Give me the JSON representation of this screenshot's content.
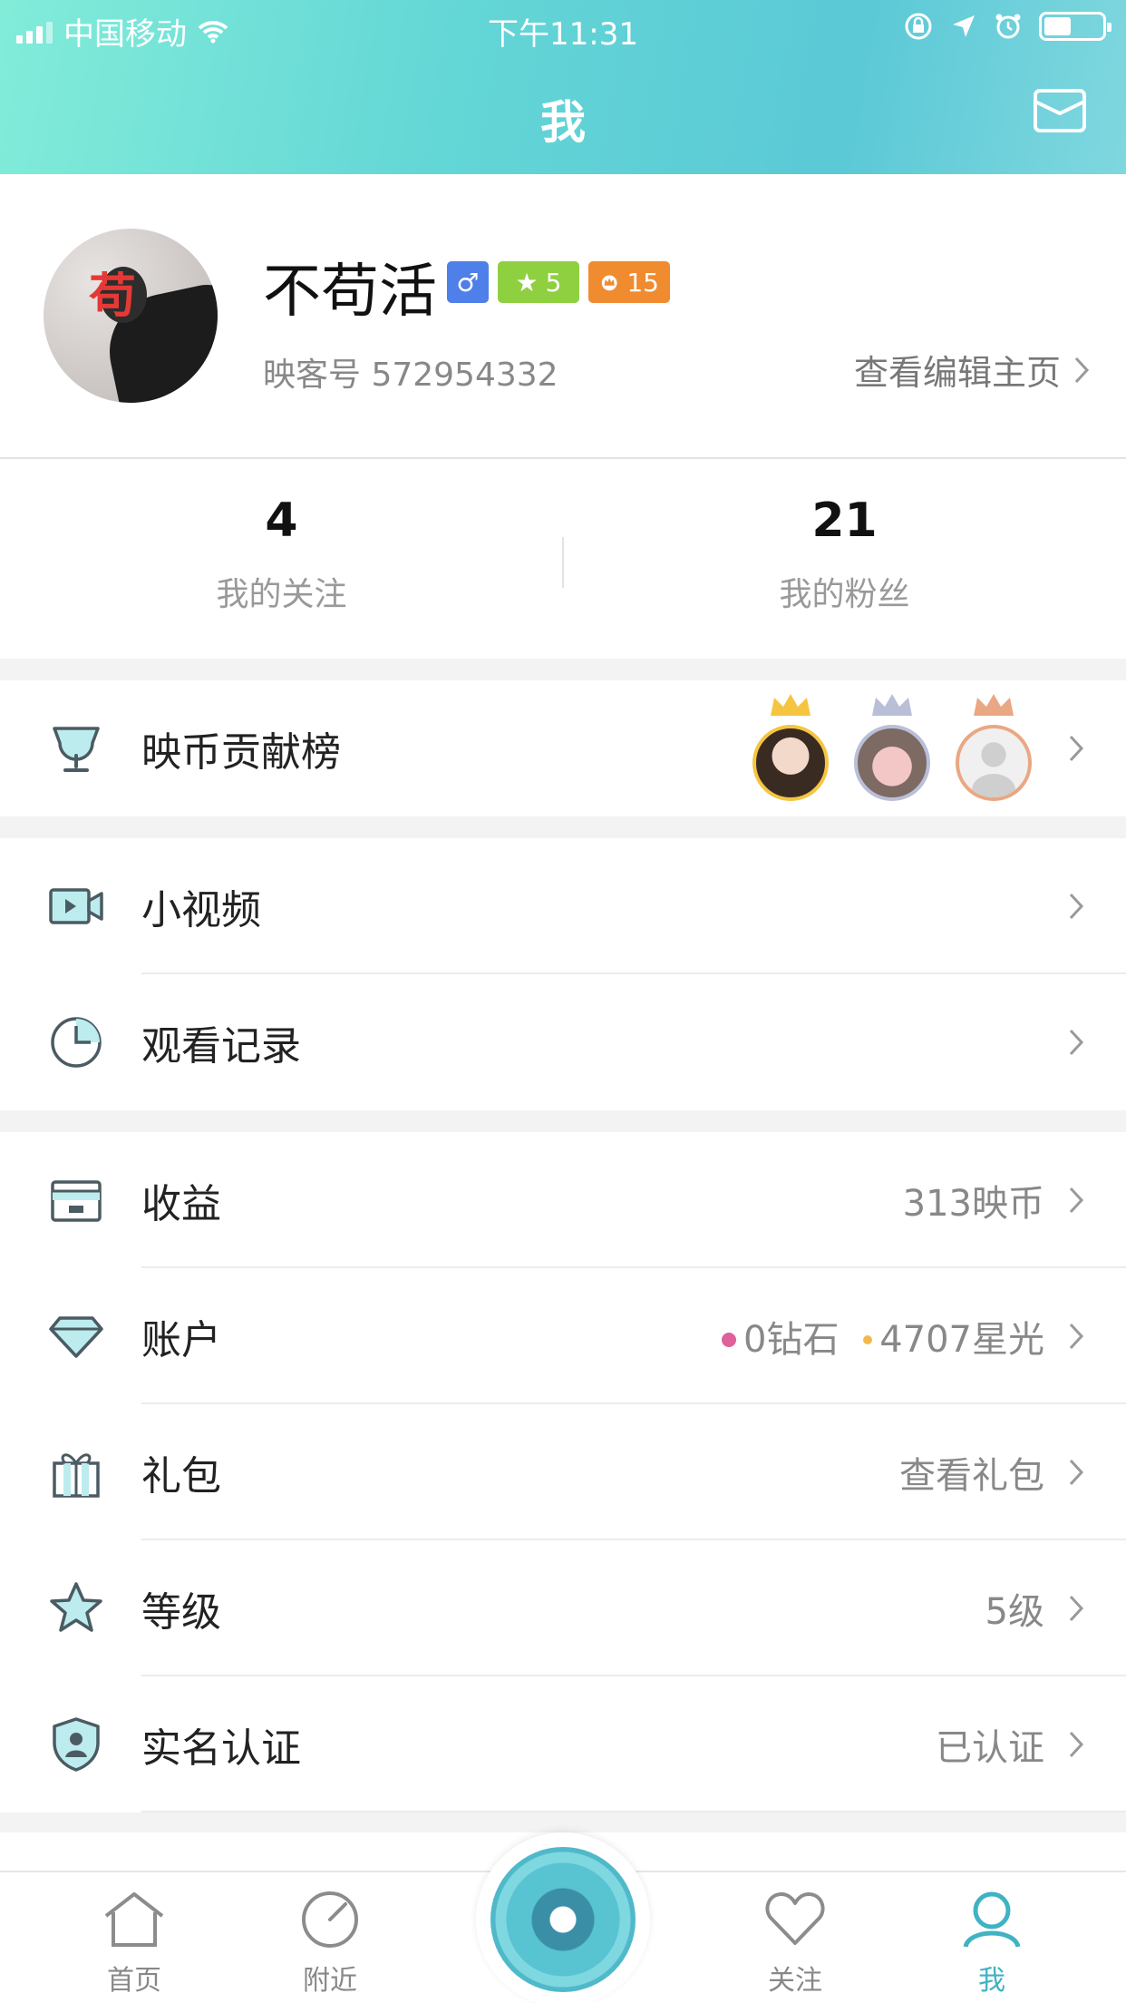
{
  "status_bar": {
    "carrier": "中国移动",
    "time": "下午11:31"
  },
  "nav": {
    "title": "我"
  },
  "profile": {
    "username": "不苟活",
    "gender_symbol": "♂",
    "level_badge": "5",
    "crown_badge": "15",
    "id_text": "映客号 572954332",
    "edit_link": "查看编辑主页"
  },
  "stats": [
    {
      "value": "4",
      "label": "我的关注"
    },
    {
      "value": "21",
      "label": "我的粉丝"
    }
  ],
  "contribution": {
    "label": "映币贡献榜"
  },
  "menu_a": [
    {
      "label": "小视频",
      "value": ""
    },
    {
      "label": "观看记录",
      "value": ""
    }
  ],
  "menu_b": {
    "income": {
      "label": "收益",
      "value": "313映币"
    },
    "account": {
      "label": "账户",
      "diamonds": "0钻石",
      "starlight": "4707星光"
    },
    "gift": {
      "label": "礼包",
      "value": "查看礼包"
    },
    "level": {
      "label": "等级",
      "value": "5级"
    },
    "verify": {
      "label": "实名认证",
      "value": "已认证"
    }
  },
  "tabs": [
    {
      "label": "首页"
    },
    {
      "label": "附近"
    },
    {
      "label": "关注"
    },
    {
      "label": "我"
    }
  ],
  "colors": {
    "accent": "#5fd0d6",
    "tab_active": "#3fb3c3",
    "gold": "#f3b84d",
    "diamond_dot": "#e0609a"
  }
}
